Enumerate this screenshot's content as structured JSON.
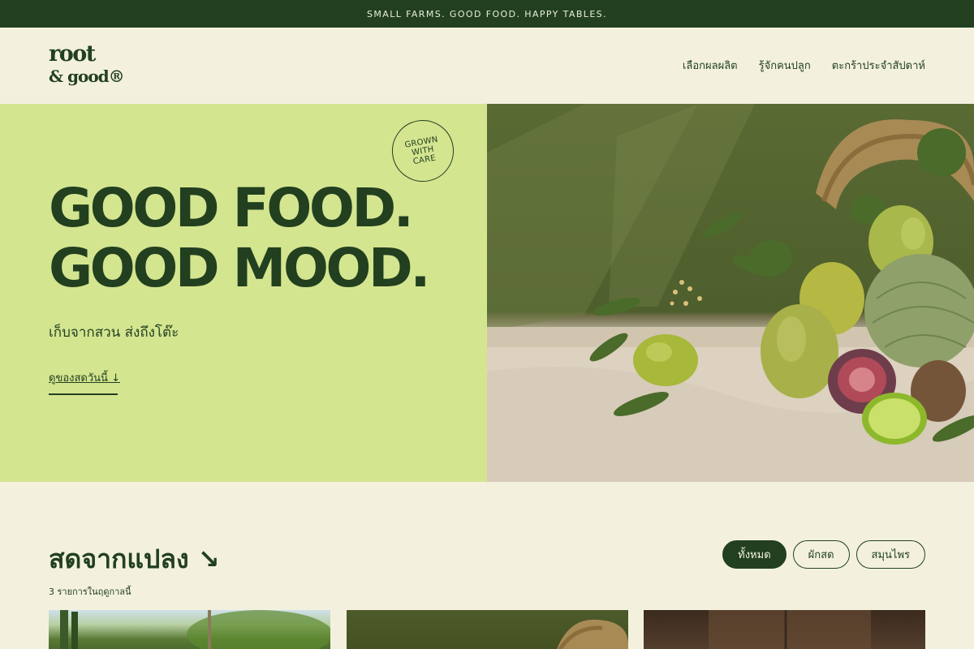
{
  "announcement": "SMALL FARMS. GOOD FOOD. HAPPY TABLES.",
  "logo": {
    "line1": "root",
    "line2": "& good®"
  },
  "nav": [
    {
      "label": "เลือกผลผลิต"
    },
    {
      "label": "รู้จักคนปลูก"
    },
    {
      "label": "ตะกร้าประจำสัปดาห์"
    }
  ],
  "hero": {
    "badge": [
      "GROWN",
      "WITH",
      "CARE"
    ],
    "title_line1": "GOOD FOOD.",
    "title_line2": "GOOD MOOD.",
    "subtitle": "เก็บจากสวน ส่งถึงโต๊ะ",
    "cta": "ดูของสดวันนี้ ↓"
  },
  "section": {
    "title": "สดจากแปลง ↘",
    "count": "3 รายการในฤดูกาลนี้",
    "filters": [
      {
        "label": "ทั้งหมด",
        "active": true
      },
      {
        "label": "ผักสด",
        "active": false
      },
      {
        "label": "สมุนไพร",
        "active": false
      }
    ]
  },
  "colors": {
    "brand_dark": "#22401f",
    "hero_green": "#d4e590",
    "cream": "#f3f1de"
  }
}
